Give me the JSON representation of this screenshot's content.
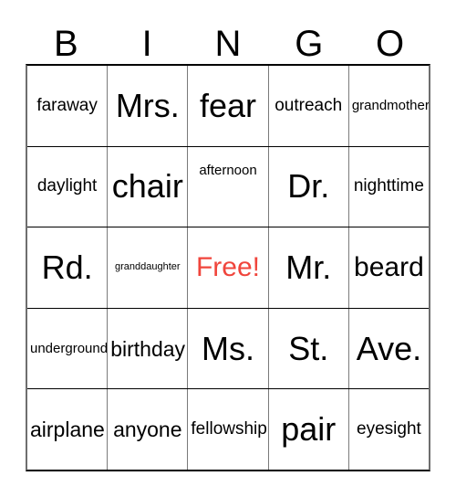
{
  "card": {
    "title": "BINGO Card",
    "header_letters": [
      "B",
      "I",
      "N",
      "G",
      "O"
    ],
    "free_color": "#f0453c",
    "text_color": "#000000",
    "border_color_horizontal": "#000000",
    "border_color_vertical": "#7a7a7a",
    "background": "#ffffff",
    "rows": [
      [
        {
          "text": "faraway",
          "size": "md",
          "free": false
        },
        {
          "text": "Mrs.",
          "size": "xxl",
          "free": false
        },
        {
          "text": "fear",
          "size": "xxl",
          "free": false
        },
        {
          "text": "outreach",
          "size": "md",
          "free": false
        },
        {
          "text": "grandmother",
          "size": "sm",
          "free": false
        }
      ],
      [
        {
          "text": "daylight",
          "size": "md",
          "free": false
        },
        {
          "text": "chair",
          "size": "xxl",
          "free": false
        },
        {
          "text": "afternoon",
          "size": "sm",
          "free": false
        },
        {
          "text": "Dr.",
          "size": "xxl",
          "free": false
        },
        {
          "text": "nighttime",
          "size": "md",
          "free": false
        }
      ],
      [
        {
          "text": "Rd.",
          "size": "xxl",
          "free": false
        },
        {
          "text": "granddaughter",
          "size": "xs",
          "free": false
        },
        {
          "text": "Free!",
          "size": "xl",
          "free": true
        },
        {
          "text": "Mr.",
          "size": "xxl",
          "free": false
        },
        {
          "text": "beard",
          "size": "xl",
          "free": false
        }
      ],
      [
        {
          "text": "underground",
          "size": "sm",
          "free": false
        },
        {
          "text": "birthday",
          "size": "lg",
          "free": false
        },
        {
          "text": "Ms.",
          "size": "xxl",
          "free": false
        },
        {
          "text": "St.",
          "size": "xxl",
          "free": false
        },
        {
          "text": "Ave.",
          "size": "xxl",
          "free": false
        }
      ],
      [
        {
          "text": "airplane",
          "size": "lg",
          "free": false
        },
        {
          "text": "anyone",
          "size": "lg",
          "free": false
        },
        {
          "text": "fellowship",
          "size": "md",
          "free": false
        },
        {
          "text": "pair",
          "size": "xxl",
          "free": false
        },
        {
          "text": "eyesight",
          "size": "md",
          "free": false
        }
      ]
    ]
  }
}
